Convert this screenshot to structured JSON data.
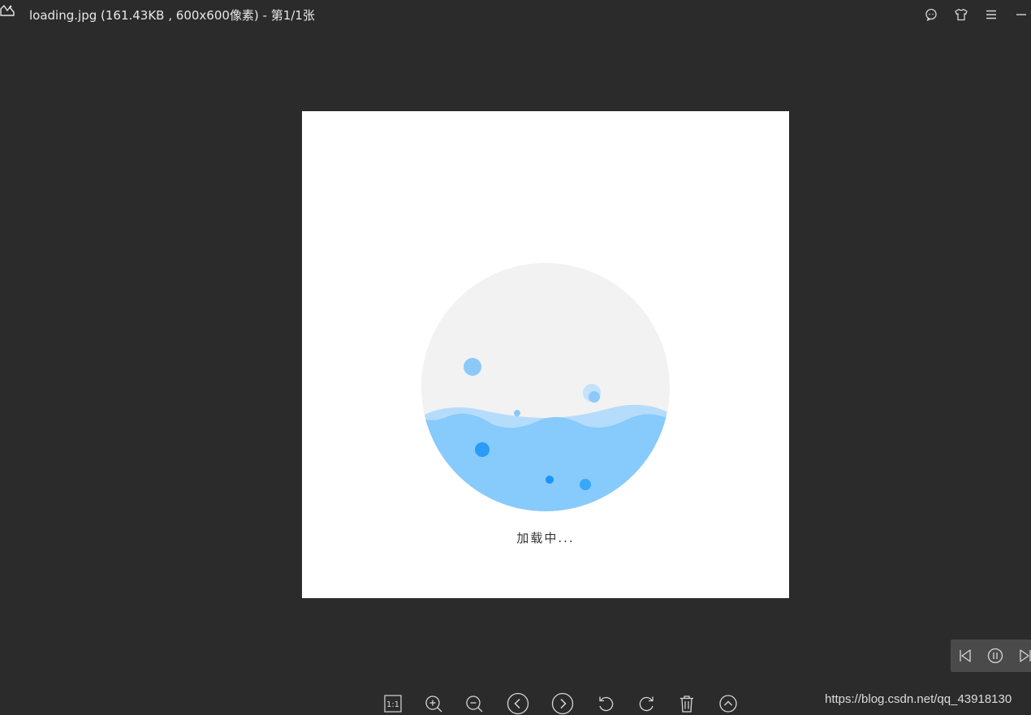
{
  "titlebar": {
    "title": "loading.jpg (161.43KB , 600x600像素) - 第1/1张",
    "app_icon": "image-viewer-logo-icon",
    "buttons": [
      {
        "name": "feedback",
        "icon": "chat-bubble-icon"
      },
      {
        "name": "skin",
        "icon": "tshirt-icon"
      },
      {
        "name": "menu",
        "icon": "hamburger-menu-icon"
      },
      {
        "name": "minimize",
        "icon": "minimize-icon"
      }
    ]
  },
  "image": {
    "loading_text": "加载中...",
    "background_color": "#ffffff",
    "circle_color": "#f2f2f2",
    "water_color": "#87cafc",
    "water_back_color": "#b5dcfb",
    "bubble_color": "#2a9cf7"
  },
  "slideshow": {
    "buttons": [
      "previous-frame-icon",
      "pause-icon",
      "next-frame-icon"
    ]
  },
  "toolbar": {
    "actual_size_label": "1:1",
    "buttons": [
      "actual-size-icon",
      "zoom-in-icon",
      "zoom-out-icon",
      "previous-icon",
      "next-icon",
      "rotate-left-icon",
      "rotate-right-icon",
      "delete-icon",
      "expand-up-icon"
    ]
  },
  "watermark": "https://blog.csdn.net/qq_43918130",
  "colors": {
    "background": "#2b2b2b",
    "text": "#e6e6e6",
    "icon_stroke": "#d6d6d6"
  }
}
